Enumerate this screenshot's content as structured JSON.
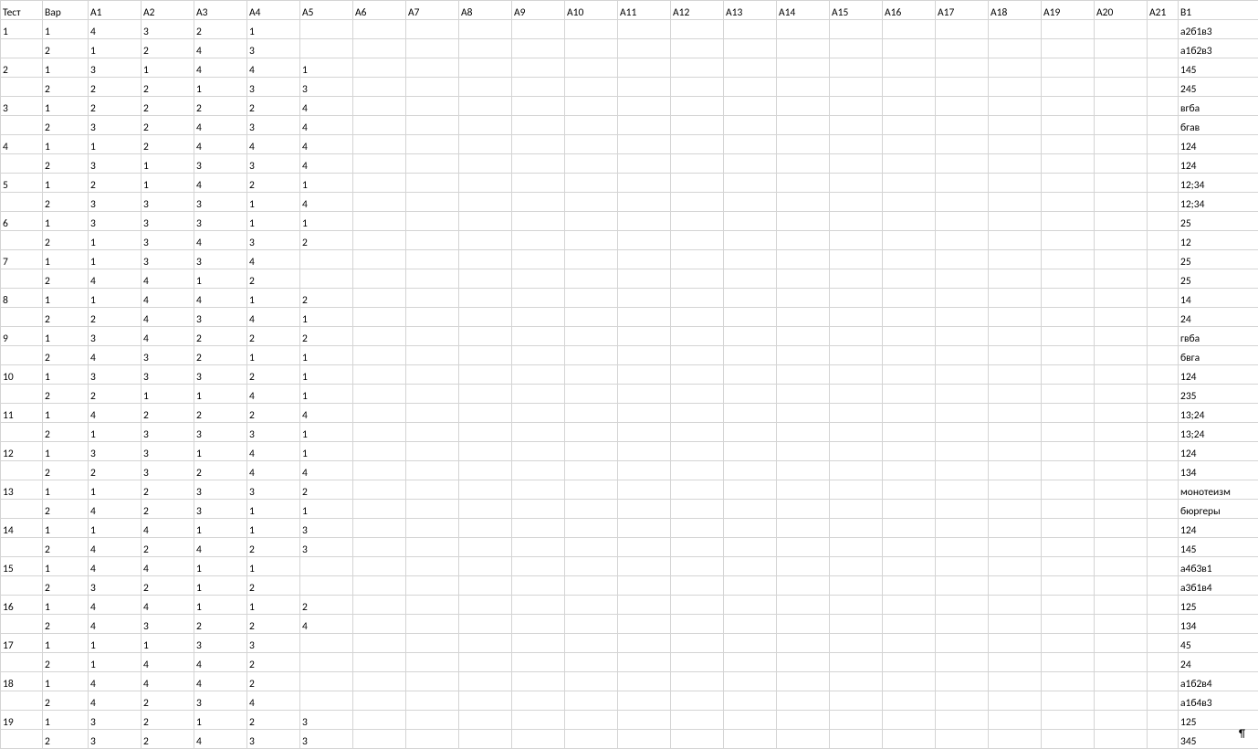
{
  "headers": [
    "Тест",
    "Вар",
    "А1",
    "А2",
    "А3",
    "А4",
    "А5",
    "А6",
    "А7",
    "А8",
    "А9",
    "А10",
    "А11",
    "А12",
    "А13",
    "А14",
    "А15",
    "А16",
    "А17",
    "А18",
    "А19",
    "А20",
    "А21",
    "В1"
  ],
  "rows": [
    {
      "test": "1",
      "var": "1",
      "a": [
        "4",
        "3",
        "2",
        "1",
        "",
        "",
        "",
        "",
        "",
        "",
        "",
        "",
        "",
        "",
        "",
        "",
        "",
        "",
        "",
        "",
        ""
      ],
      "b1": "а2б1в3"
    },
    {
      "test": "",
      "var": "2",
      "a": [
        "1",
        "2",
        "4",
        "3",
        "",
        "",
        "",
        "",
        "",
        "",
        "",
        "",
        "",
        "",
        "",
        "",
        "",
        "",
        "",
        "",
        ""
      ],
      "b1": "а1б2в3"
    },
    {
      "test": "2",
      "var": "1",
      "a": [
        "3",
        "1",
        "4",
        "4",
        "1",
        "",
        "",
        "",
        "",
        "",
        "",
        "",
        "",
        "",
        "",
        "",
        "",
        "",
        "",
        "",
        ""
      ],
      "b1": "145"
    },
    {
      "test": "",
      "var": "2",
      "a": [
        "2",
        "2",
        "1",
        "3",
        "3",
        "",
        "",
        "",
        "",
        "",
        "",
        "",
        "",
        "",
        "",
        "",
        "",
        "",
        "",
        "",
        ""
      ],
      "b1": "245"
    },
    {
      "test": "3",
      "var": "1",
      "a": [
        "2",
        "2",
        "2",
        "2",
        "4",
        "",
        "",
        "",
        "",
        "",
        "",
        "",
        "",
        "",
        "",
        "",
        "",
        "",
        "",
        "",
        ""
      ],
      "b1": "вгба"
    },
    {
      "test": "",
      "var": "2",
      "a": [
        "3",
        "2",
        "4",
        "3",
        "4",
        "",
        "",
        "",
        "",
        "",
        "",
        "",
        "",
        "",
        "",
        "",
        "",
        "",
        "",
        "",
        ""
      ],
      "b1": "бгав"
    },
    {
      "test": "4",
      "var": "1",
      "a": [
        "1",
        "2",
        "4",
        "4",
        "4",
        "",
        "",
        "",
        "",
        "",
        "",
        "",
        "",
        "",
        "",
        "",
        "",
        "",
        "",
        "",
        ""
      ],
      "b1": "124"
    },
    {
      "test": "",
      "var": "2",
      "a": [
        "3",
        "1",
        "3",
        "3",
        "4",
        "",
        "",
        "",
        "",
        "",
        "",
        "",
        "",
        "",
        "",
        "",
        "",
        "",
        "",
        "",
        ""
      ],
      "b1": "124"
    },
    {
      "test": "5",
      "var": "1",
      "a": [
        "2",
        "1",
        "4",
        "2",
        "1",
        "",
        "",
        "",
        "",
        "",
        "",
        "",
        "",
        "",
        "",
        "",
        "",
        "",
        "",
        "",
        ""
      ],
      "b1": "12;34"
    },
    {
      "test": "",
      "var": "2",
      "a": [
        "3",
        "3",
        "3",
        "1",
        "4",
        "",
        "",
        "",
        "",
        "",
        "",
        "",
        "",
        "",
        "",
        "",
        "",
        "",
        "",
        "",
        ""
      ],
      "b1": "12;34"
    },
    {
      "test": "6",
      "var": "1",
      "a": [
        "3",
        "3",
        "3",
        "1",
        "1",
        "",
        "",
        "",
        "",
        "",
        "",
        "",
        "",
        "",
        "",
        "",
        "",
        "",
        "",
        "",
        ""
      ],
      "b1": "25"
    },
    {
      "test": "",
      "var": "2",
      "a": [
        "1",
        "3",
        "4",
        "3",
        "2",
        "",
        "",
        "",
        "",
        "",
        "",
        "",
        "",
        "",
        "",
        "",
        "",
        "",
        "",
        "",
        ""
      ],
      "b1": "12"
    },
    {
      "test": "7",
      "var": "1",
      "a": [
        "1",
        "3",
        "3",
        "4",
        "",
        "",
        "",
        "",
        "",
        "",
        "",
        "",
        "",
        "",
        "",
        "",
        "",
        "",
        "",
        "",
        ""
      ],
      "b1": "25"
    },
    {
      "test": "",
      "var": "2",
      "a": [
        "4",
        "4",
        "1",
        "2",
        "",
        "",
        "",
        "",
        "",
        "",
        "",
        "",
        "",
        "",
        "",
        "",
        "",
        "",
        "",
        "",
        ""
      ],
      "b1": "25"
    },
    {
      "test": "8",
      "var": "1",
      "a": [
        "1",
        "4",
        "4",
        "1",
        "2",
        "",
        "",
        "",
        "",
        "",
        "",
        "",
        "",
        "",
        "",
        "",
        "",
        "",
        "",
        "",
        ""
      ],
      "b1": "14"
    },
    {
      "test": "",
      "var": "2",
      "a": [
        "2",
        "4",
        "3",
        "4",
        "1",
        "",
        "",
        "",
        "",
        "",
        "",
        "",
        "",
        "",
        "",
        "",
        "",
        "",
        "",
        "",
        ""
      ],
      "b1": "24"
    },
    {
      "test": "9",
      "var": "1",
      "a": [
        "3",
        "4",
        "2",
        "2",
        "2",
        "",
        "",
        "",
        "",
        "",
        "",
        "",
        "",
        "",
        "",
        "",
        "",
        "",
        "",
        "",
        ""
      ],
      "b1": "гвба"
    },
    {
      "test": "",
      "var": "2",
      "a": [
        "4",
        "3",
        "2",
        "1",
        "1",
        "",
        "",
        "",
        "",
        "",
        "",
        "",
        "",
        "",
        "",
        "",
        "",
        "",
        "",
        "",
        ""
      ],
      "b1": "бвга"
    },
    {
      "test": "10",
      "var": "1",
      "a": [
        "3",
        "3",
        "3",
        "2",
        "1",
        "",
        "",
        "",
        "",
        "",
        "",
        "",
        "",
        "",
        "",
        "",
        "",
        "",
        "",
        "",
        ""
      ],
      "b1": "124"
    },
    {
      "test": "",
      "var": "2",
      "a": [
        "2",
        "1",
        "1",
        "4",
        "1",
        "",
        "",
        "",
        "",
        "",
        "",
        "",
        "",
        "",
        "",
        "",
        "",
        "",
        "",
        "",
        ""
      ],
      "b1": "235"
    },
    {
      "test": "11",
      "var": "1",
      "a": [
        "4",
        "2",
        "2",
        "2",
        "4",
        "",
        "",
        "",
        "",
        "",
        "",
        "",
        "",
        "",
        "",
        "",
        "",
        "",
        "",
        "",
        ""
      ],
      "b1": "13;24"
    },
    {
      "test": "",
      "var": "2",
      "a": [
        "1",
        "3",
        "3",
        "3",
        "1",
        "",
        "",
        "",
        "",
        "",
        "",
        "",
        "",
        "",
        "",
        "",
        "",
        "",
        "",
        "",
        ""
      ],
      "b1": "13;24"
    },
    {
      "test": "12",
      "var": "1",
      "a": [
        "3",
        "3",
        "1",
        "4",
        "1",
        "",
        "",
        "",
        "",
        "",
        "",
        "",
        "",
        "",
        "",
        "",
        "",
        "",
        "",
        "",
        ""
      ],
      "b1": "124"
    },
    {
      "test": "",
      "var": "2",
      "a": [
        "2",
        "3",
        "2",
        "4",
        "4",
        "",
        "",
        "",
        "",
        "",
        "",
        "",
        "",
        "",
        "",
        "",
        "",
        "",
        "",
        "",
        ""
      ],
      "b1": "134"
    },
    {
      "test": "13",
      "var": "1",
      "a": [
        "1",
        "2",
        "3",
        "3",
        "2",
        "",
        "",
        "",
        "",
        "",
        "",
        "",
        "",
        "",
        "",
        "",
        "",
        "",
        "",
        "",
        ""
      ],
      "b1": "монотеизм"
    },
    {
      "test": "",
      "var": "2",
      "a": [
        "4",
        "2",
        "3",
        "1",
        "1",
        "",
        "",
        "",
        "",
        "",
        "",
        "",
        "",
        "",
        "",
        "",
        "",
        "",
        "",
        "",
        ""
      ],
      "b1": "бюргеры"
    },
    {
      "test": "14",
      "var": "1",
      "a": [
        "1",
        "4",
        "1",
        "1",
        "3",
        "",
        "",
        "",
        "",
        "",
        "",
        "",
        "",
        "",
        "",
        "",
        "",
        "",
        "",
        "",
        ""
      ],
      "b1": "124"
    },
    {
      "test": "",
      "var": "2",
      "a": [
        "4",
        "2",
        "4",
        "2",
        "3",
        "",
        "",
        "",
        "",
        "",
        "",
        "",
        "",
        "",
        "",
        "",
        "",
        "",
        "",
        "",
        ""
      ],
      "b1": "145"
    },
    {
      "test": "15",
      "var": "1",
      "a": [
        "4",
        "4",
        "1",
        "1",
        "",
        "",
        "",
        "",
        "",
        "",
        "",
        "",
        "",
        "",
        "",
        "",
        "",
        "",
        "",
        "",
        ""
      ],
      "b1": "а4б3в1"
    },
    {
      "test": "",
      "var": "2",
      "a": [
        "3",
        "2",
        "1",
        "2",
        "",
        "",
        "",
        "",
        "",
        "",
        "",
        "",
        "",
        "",
        "",
        "",
        "",
        "",
        "",
        "",
        ""
      ],
      "b1": "а3б1в4"
    },
    {
      "test": "16",
      "var": "1",
      "a": [
        "4",
        "4",
        "1",
        "1",
        "2",
        "",
        "",
        "",
        "",
        "",
        "",
        "",
        "",
        "",
        "",
        "",
        "",
        "",
        "",
        "",
        ""
      ],
      "b1": "125"
    },
    {
      "test": "",
      "var": "2",
      "a": [
        "4",
        "3",
        "2",
        "2",
        "4",
        "",
        "",
        "",
        "",
        "",
        "",
        "",
        "",
        "",
        "",
        "",
        "",
        "",
        "",
        "",
        ""
      ],
      "b1": "134"
    },
    {
      "test": "17",
      "var": "1",
      "a": [
        "1",
        "1",
        "3",
        "3",
        "",
        "",
        "",
        "",
        "",
        "",
        "",
        "",
        "",
        "",
        "",
        "",
        "",
        "",
        "",
        "",
        ""
      ],
      "b1": "45"
    },
    {
      "test": "",
      "var": "2",
      "a": [
        "1",
        "4",
        "4",
        "2",
        "",
        "",
        "",
        "",
        "",
        "",
        "",
        "",
        "",
        "",
        "",
        "",
        "",
        "",
        "",
        "",
        ""
      ],
      "b1": "24"
    },
    {
      "test": "18",
      "var": "1",
      "a": [
        "4",
        "4",
        "4",
        "2",
        "",
        "",
        "",
        "",
        "",
        "",
        "",
        "",
        "",
        "",
        "",
        "",
        "",
        "",
        "",
        "",
        ""
      ],
      "b1": "а1б2в4"
    },
    {
      "test": "",
      "var": "2",
      "a": [
        "4",
        "2",
        "3",
        "4",
        "",
        "",
        "",
        "",
        "",
        "",
        "",
        "",
        "",
        "",
        "",
        "",
        "",
        "",
        "",
        "",
        ""
      ],
      "b1": "а1б4в3"
    },
    {
      "test": "19",
      "var": "1",
      "a": [
        "3",
        "2",
        "1",
        "2",
        "3",
        "",
        "",
        "",
        "",
        "",
        "",
        "",
        "",
        "",
        "",
        "",
        "",
        "",
        "",
        "",
        ""
      ],
      "b1": "125"
    },
    {
      "test": "",
      "var": "2",
      "a": [
        "3",
        "2",
        "4",
        "3",
        "3",
        "",
        "",
        "",
        "",
        "",
        "",
        "",
        "",
        "",
        "",
        "",
        "",
        "",
        "",
        "",
        ""
      ],
      "b1": "345"
    }
  ],
  "pilcrow": "¶"
}
